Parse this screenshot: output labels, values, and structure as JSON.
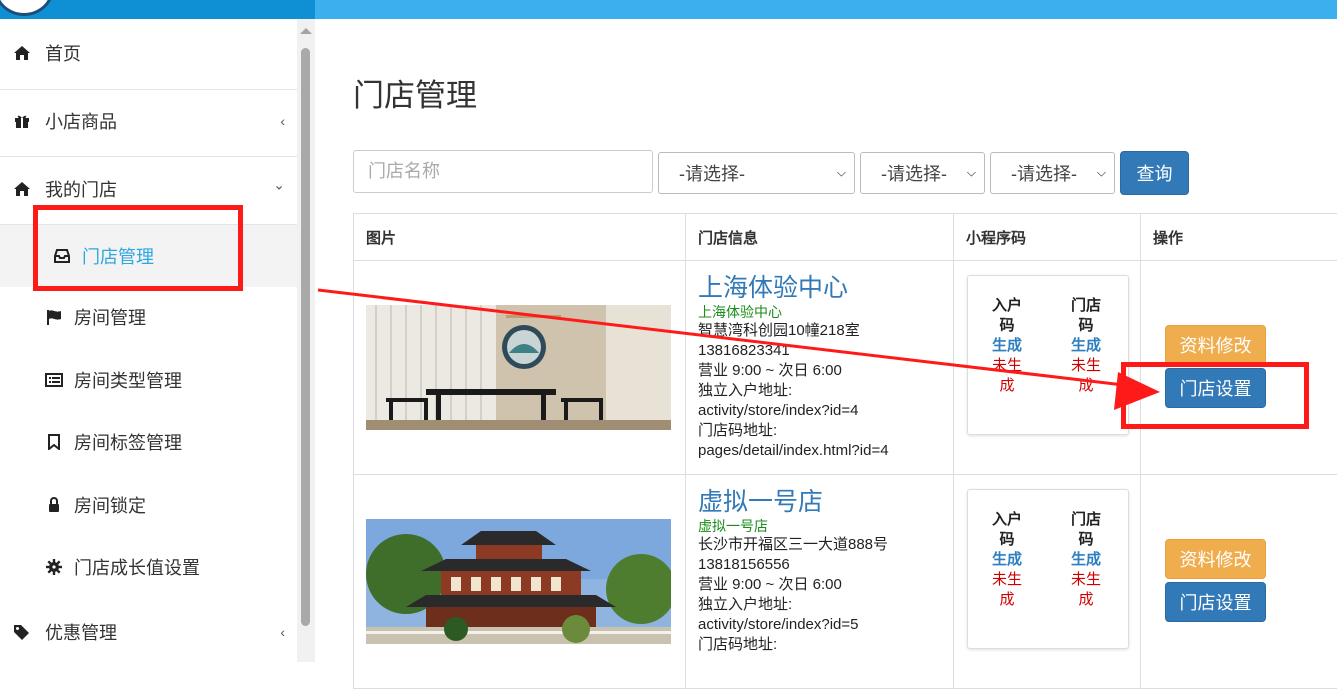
{
  "sidebar": {
    "items": [
      {
        "label": "首页",
        "icon": "home-icon"
      },
      {
        "label": "小店商品",
        "icon": "gift-icon",
        "chevron": "‹"
      },
      {
        "label": "我的门店",
        "icon": "home-icon",
        "chevron": "⌄"
      },
      {
        "label": "门店管理",
        "icon": "inbox-icon"
      },
      {
        "label": "房间管理",
        "icon": "flag-icon"
      },
      {
        "label": "房间类型管理",
        "icon": "list-icon"
      },
      {
        "label": "房间标签管理",
        "icon": "bookmark-icon"
      },
      {
        "label": "房间锁定",
        "icon": "lock-icon"
      },
      {
        "label": "门店成长值设置",
        "icon": "gear-icon"
      },
      {
        "label": "优惠管理",
        "icon": "tags-icon",
        "chevron": "‹"
      }
    ]
  },
  "main": {
    "title": "门店管理",
    "search": {
      "placeholder": "门店名称",
      "button": "查询"
    },
    "selects": [
      "-请选择-",
      "-请选择-",
      "-请选择-"
    ],
    "table": {
      "headers": [
        "图片",
        "门店信息",
        "小程序码",
        "操作"
      ],
      "rows": [
        {
          "name": "上海体验中心",
          "subname": "上海体验中心",
          "address": "智慧湾科创园10幢218室",
          "phone": "13816823341",
          "hours": "营业 9:00 ~ 次日 6:00",
          "entry_label": "独立入户地址:",
          "entry_url": "activity/store/index?id=4",
          "code_label": "门店码地址:",
          "code_url": "pages/detail/index.html?id=4",
          "qr": {
            "col1_label": "入户码",
            "col2_label": "门店码",
            "gen": "生成",
            "no": "未生成"
          },
          "edit": "资料修改",
          "settings": "门店设置"
        },
        {
          "name": "虚拟一号店",
          "subname": "虚拟一号店",
          "address": "长沙市开福区三一大道888号",
          "phone": "13818156556",
          "hours": "营业 9:00 ~ 次日 6:00",
          "entry_label": "独立入户地址:",
          "entry_url": "activity/store/index?id=5",
          "code_label": "门店码地址:",
          "code_url": "",
          "qr": {
            "col1_label": "入户码",
            "col2_label": "门店码",
            "gen": "生成",
            "no": "未生成"
          },
          "edit": "资料修改",
          "settings": "门店设置"
        }
      ]
    }
  },
  "colors": {
    "accent": "#2ea7e0",
    "primary": "#3279b7",
    "warning": "#f0ad4e",
    "highlight": "#ff1a1a"
  }
}
